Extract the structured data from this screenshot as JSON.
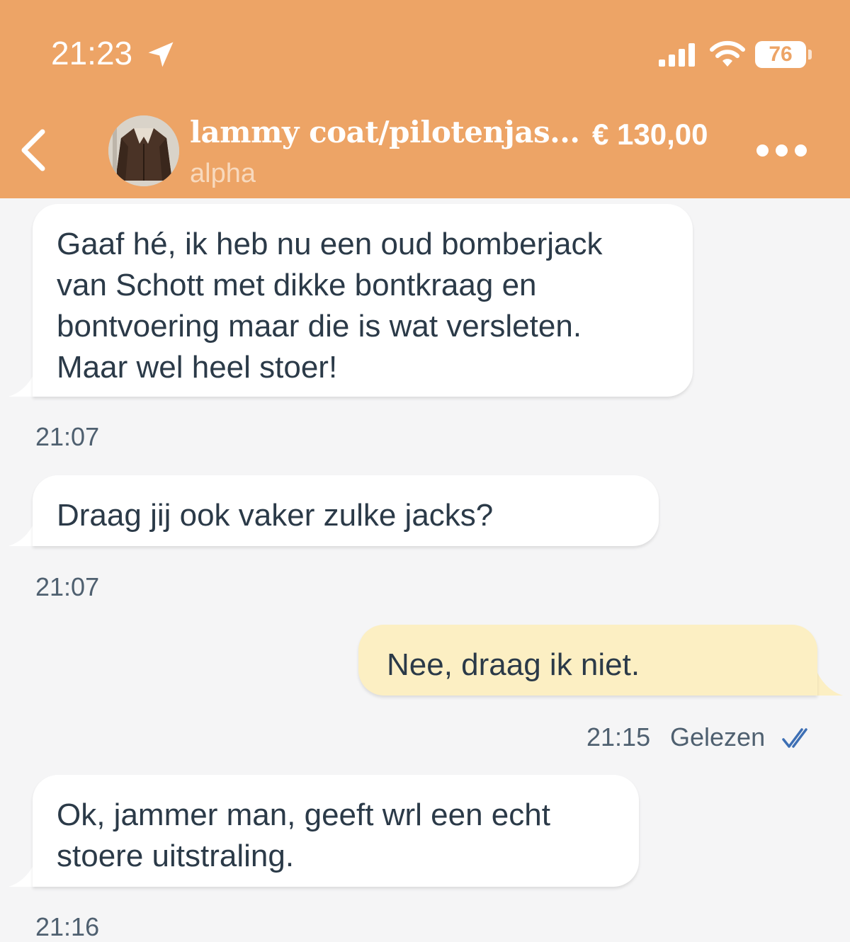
{
  "status_bar": {
    "time": "21:23",
    "battery": "76"
  },
  "header": {
    "title": "lammy coat/pilotenjas...",
    "price": "€ 130,00",
    "subtitle": "alpha"
  },
  "messages": [
    {
      "direction": "incoming",
      "lines": [
        "Gaaf hé, ik heb nu een oud bomberjack",
        "van Schott met dikke bontkraag en",
        "bontvoering maar die is wat versleten.",
        "Maar wel heel stoer!"
      ],
      "time": "21:07"
    },
    {
      "direction": "incoming",
      "lines": [
        "Draag jij ook vaker zulke jacks?"
      ],
      "time": "21:07"
    },
    {
      "direction": "outgoing",
      "lines": [
        "Nee, draag ik niet."
      ],
      "time": "21:15",
      "status": "Gelezen"
    },
    {
      "direction": "incoming",
      "lines": [
        "Ok, jammer man, geeft wrl een echt",
        "stoere uitstraling."
      ],
      "time": "21:16"
    }
  ],
  "colors": {
    "header_bg": "#eda466",
    "chat_bg": "#f5f5f6",
    "incoming_bubble": "#ffffff",
    "outgoing_bubble": "#fcefc3",
    "read_check": "#3d6fb4"
  },
  "icons": {
    "location": "location-arrow-icon",
    "signal": "cellular-signal-icon",
    "wifi": "wifi-icon",
    "back": "chevron-left-icon",
    "more": "more-dots-icon",
    "read": "double-check-icon"
  }
}
